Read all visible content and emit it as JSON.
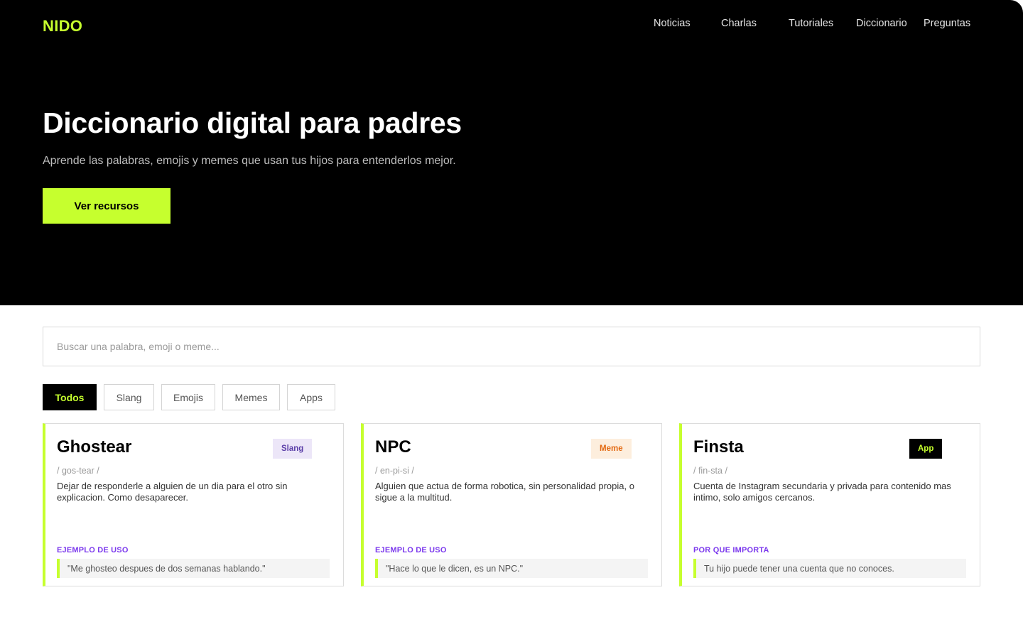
{
  "brand": {
    "logo": "NIDO",
    "accent": "#c6ff2e"
  },
  "nav": {
    "items": [
      {
        "label": "Noticias"
      },
      {
        "label": "Charlas"
      },
      {
        "label": "Tutoriales"
      },
      {
        "label": "Diccionario"
      },
      {
        "label": "Preguntas"
      }
    ]
  },
  "hero": {
    "title": "Diccionario digital para padres",
    "subtitle": "Aprende las palabras, emojis y memes que usan tus hijos para entenderlos mejor.",
    "cta_label": "Ver recursos"
  },
  "search": {
    "placeholder": "Buscar una palabra, emoji o meme..."
  },
  "filters": {
    "items": [
      {
        "label": "Todos",
        "active": true
      },
      {
        "label": "Slang",
        "active": false
      },
      {
        "label": "Emojis",
        "active": false
      },
      {
        "label": "Memes",
        "active": false
      },
      {
        "label": "Apps",
        "active": false
      }
    ]
  },
  "cards": [
    {
      "title": "Ghostear",
      "tag": "Slang",
      "pronunciation": "/ gos-tear /",
      "definition": "Dejar de responderle a alguien de un dia para el otro sin explicacion. Como desaparecer.",
      "section_label": "EJEMPLO DE USO",
      "example": "\"Me ghosteo despues de dos semanas hablando.\""
    },
    {
      "title": "NPC",
      "tag": "Meme",
      "pronunciation": "/ en-pi-si /",
      "definition": "Alguien que actua de forma robotica, sin personalidad propia, o sigue a la multitud.",
      "section_label": "EJEMPLO DE USO",
      "example": "\"Hace lo que le dicen, es un NPC.\""
    },
    {
      "title": "Finsta",
      "tag": "App",
      "pronunciation": "/ fin-sta /",
      "definition": "Cuenta de Instagram secundaria y privada para contenido mas intimo, solo amigos cercanos.",
      "section_label": "POR QUE IMPORTA",
      "example": "Tu hijo puede tener una cuenta que no conoces."
    }
  ]
}
